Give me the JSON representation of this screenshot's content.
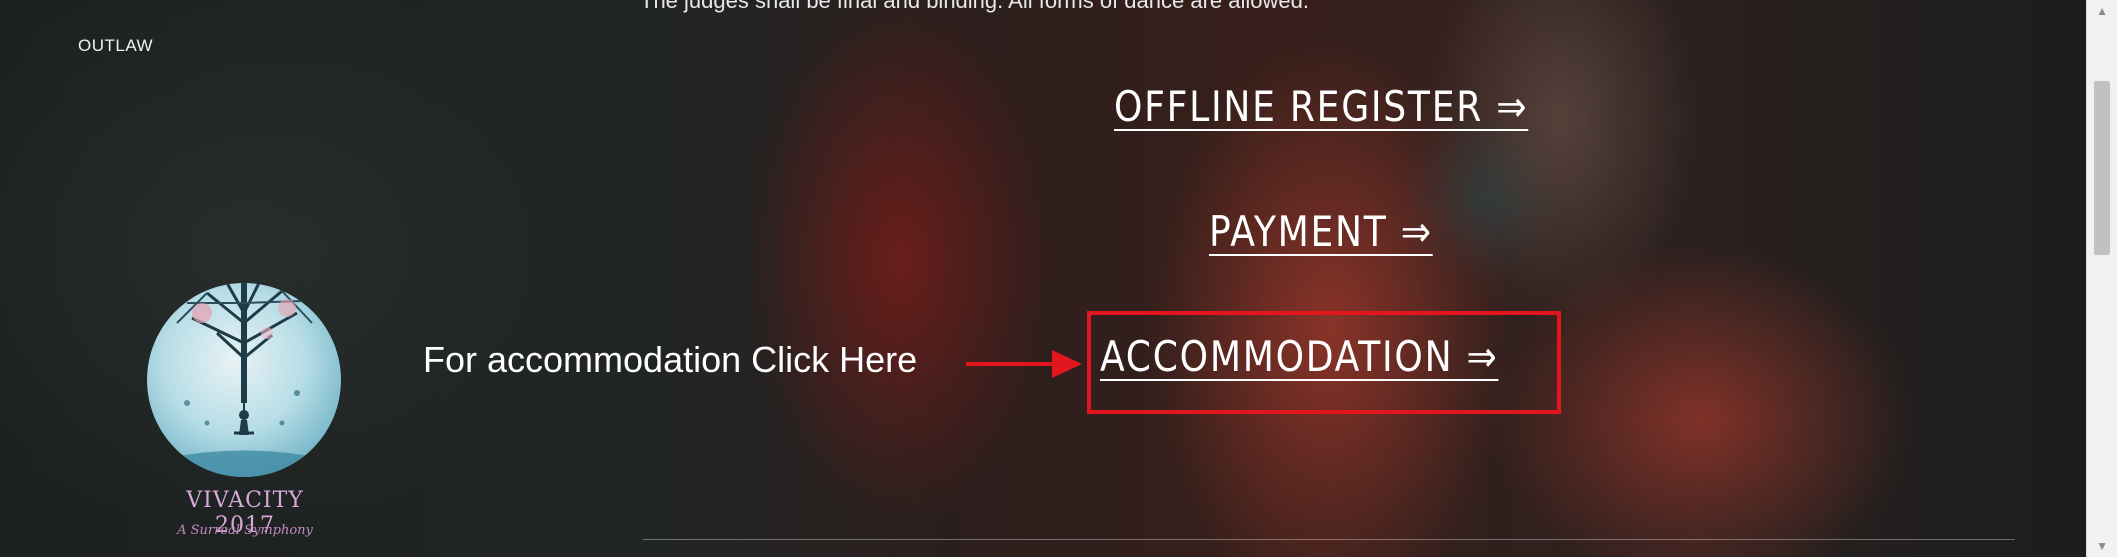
{
  "page": {
    "top_text": "The judges shall be final and binding. All forms of dance are allowed.",
    "side_label": "OUTLAW"
  },
  "links": {
    "offline_register": "OFFLINE REGISTER ⇒",
    "payment": "PAYMENT ⇒",
    "accommodation": "ACCOMMODATION ⇒"
  },
  "annotation": {
    "text": "For accommodation Click Here",
    "color": "#e2161e"
  },
  "logo": {
    "title": "VIVACITY 2017",
    "subtitle": "A Surreal Symphony"
  },
  "icons": {
    "scroll_up": "scroll-up-arrow-icon",
    "scroll_down": "scroll-down-arrow-icon",
    "annotation_arrow": "red-arrow-icon"
  }
}
